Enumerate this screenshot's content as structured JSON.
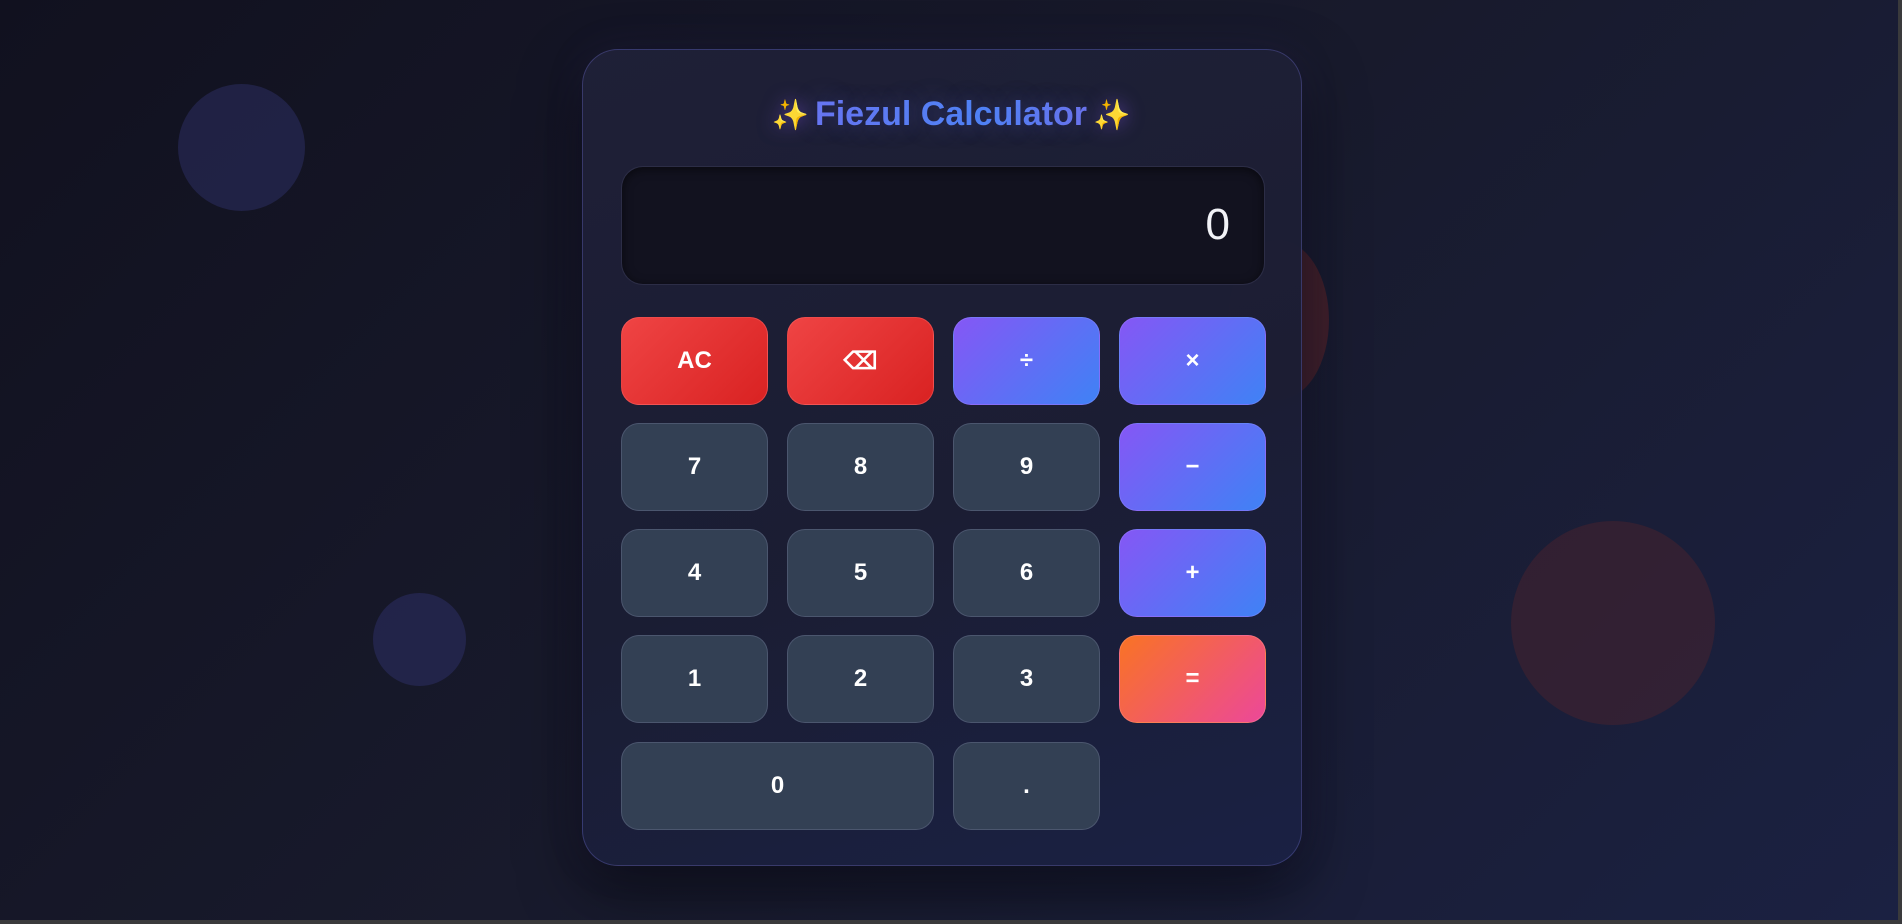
{
  "app": {
    "title": "Fiezul Calculator",
    "title_prefix_icon": "✨",
    "title_suffix_icon": "✨"
  },
  "display": {
    "value": "0"
  },
  "buttons": {
    "clear": "AC",
    "backspace": "⌫",
    "divide": "÷",
    "multiply": "×",
    "seven": "7",
    "eight": "8",
    "nine": "9",
    "subtract": "−",
    "four": "4",
    "five": "5",
    "six": "6",
    "add": "+",
    "one": "1",
    "two": "2",
    "three": "3",
    "equals": "=",
    "zero": "0",
    "decimal": "."
  },
  "colors": {
    "danger": "#ef4444",
    "operator_start": "#8557f5",
    "operator_end": "#3f82f5",
    "equals_start": "#f97324",
    "equals_end": "#ec4899",
    "number": "#334054"
  }
}
